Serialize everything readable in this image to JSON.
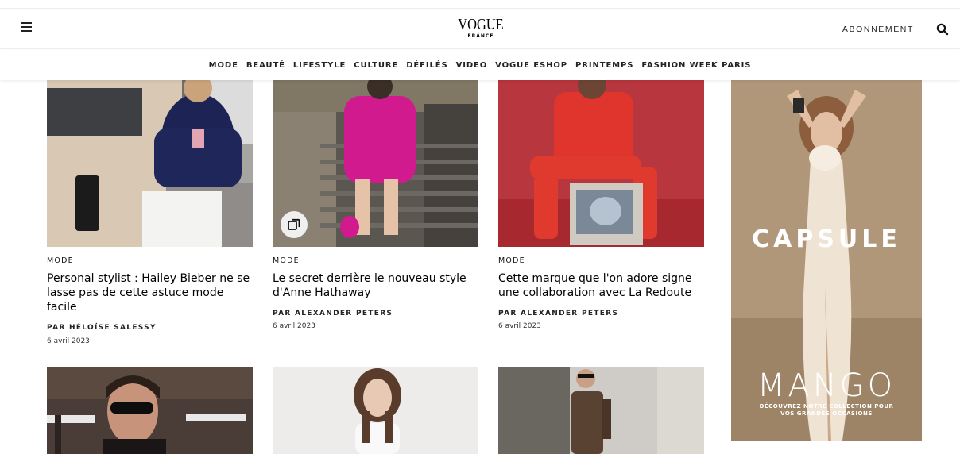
{
  "header": {
    "logo_word": "VOGUE",
    "logo_sub": "FRANCE",
    "subscribe_label": "ABONNEMENT"
  },
  "nav": {
    "items": [
      "MODE",
      "BEAUTÉ",
      "LIFESTYLE",
      "CULTURE",
      "DÉFILÉS",
      "VIDEO",
      "VOGUE ESHOP",
      "PRINTEMPS",
      "FASHION WEEK PARIS"
    ]
  },
  "articles": [
    {
      "rubric": "MODE",
      "title": "Personal stylist : Hailey Bieber ne se lasse pas de cette astuce mode facile",
      "author": "PAR HÉLOÏSE SALESSY",
      "date": "6 avril 2023"
    },
    {
      "rubric": "MODE",
      "title": "Le secret derrière le nouveau style d'Anne Hathaway",
      "author": "PAR ALEXANDER PETERS",
      "date": "6 avril 2023",
      "badge_icon": "gallery-icon"
    },
    {
      "rubric": "MODE",
      "title": "Cette marque que l'on adore signe une collaboration avec La Redoute",
      "author": "PAR ALEXANDER PETERS",
      "date": "6 avril 2023"
    }
  ],
  "ad": {
    "title": "CAPSULE",
    "brand": "MANGO",
    "tagline_1": "DÉCOUVREZ NOTRE COLLECTION POUR",
    "tagline_2": "VOS GRANDES OCCASIONS"
  },
  "icons": {
    "menu": "hamburger-menu-icon",
    "search": "search-icon",
    "gallery": "gallery-icon"
  }
}
